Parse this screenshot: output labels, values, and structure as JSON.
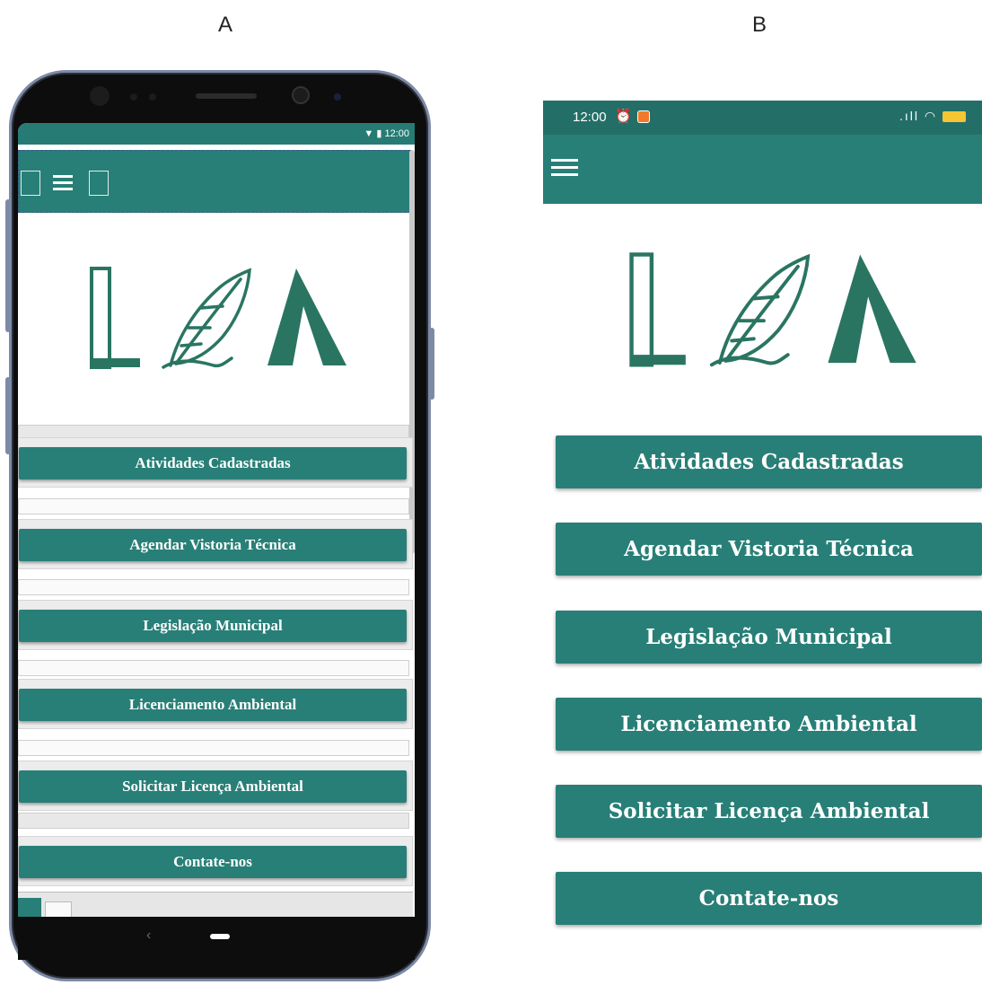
{
  "panels": {
    "a_label": "A",
    "b_label": "B"
  },
  "colors": {
    "primary": "#287f77",
    "status_bar": "#236f68",
    "logo_green": "#2a7562"
  },
  "panel_a": {
    "status_time": "12:00",
    "menu_icon": "hamburger-menu-icon",
    "buttons": [
      "Atividades Cadastradas",
      "Agendar Vistoria Técnica",
      "Legislação Municipal",
      "Licenciamento Ambiental",
      "Solicitar Licença Ambiental",
      "Contate-nos"
    ]
  },
  "panel_b": {
    "status_time": "12:00",
    "battery_icon": "battery-icon",
    "menu_icon": "hamburger-menu-icon",
    "buttons": [
      "Atividades Cadastradas",
      "Agendar Vistoria Técnica",
      "Legislação Municipal",
      "Licenciamento Ambiental",
      "Solicitar Licença Ambiental",
      "Contate-nos"
    ]
  }
}
